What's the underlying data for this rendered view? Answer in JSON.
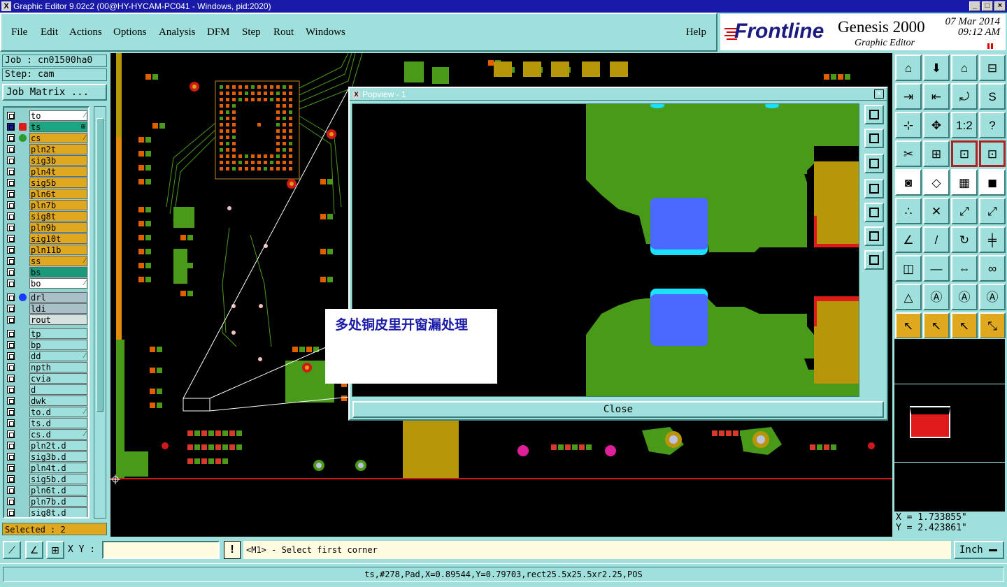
{
  "window": {
    "title": "Graphic Editor 9.02c2 (00@HY-HYCAM-PC041 - Windows, pid:2020)",
    "min": "_",
    "max": "□",
    "close": "×"
  },
  "menu": {
    "items": [
      "File",
      "Edit",
      "Actions",
      "Options",
      "Analysis",
      "DFM",
      "Step",
      "Rout",
      "Windows"
    ],
    "help": "Help"
  },
  "brand": {
    "frontline": "Frontline",
    "product": "Genesis 2000",
    "subtitle": "Graphic Editor",
    "date": "07 Mar 2014",
    "time": "09:12 AM",
    "accent": "#1a1a80"
  },
  "job": {
    "job_label": "Job : cn01500ha0",
    "step_label": "Step: cam",
    "matrix_button": "Job Matrix ..."
  },
  "layers": [
    {
      "name": "to",
      "style": "white",
      "mark": "⁄"
    },
    {
      "name": "ts",
      "style": "teal",
      "mark": "⊞",
      "active": true
    },
    {
      "name": "cs",
      "style": "gold",
      "mark": "⁄",
      "dot": "#2a9a2a"
    },
    {
      "name": "pln2t",
      "style": "gold"
    },
    {
      "name": "sig3b",
      "style": "gold"
    },
    {
      "name": "pln4t",
      "style": "gold"
    },
    {
      "name": "sig5b",
      "style": "gold"
    },
    {
      "name": "pln6t",
      "style": "gold"
    },
    {
      "name": "pln7b",
      "style": "gold"
    },
    {
      "name": "sig8t",
      "style": "gold"
    },
    {
      "name": "pln9b",
      "style": "gold"
    },
    {
      "name": "sig10t",
      "style": "gold"
    },
    {
      "name": "pln11b",
      "style": "gold"
    },
    {
      "name": "ss",
      "style": "gold",
      "mark": "⁄"
    },
    {
      "name": "bs",
      "style": "green"
    },
    {
      "name": "bo",
      "style": "white",
      "mark": "⁄"
    },
    {
      "name": "drl",
      "style": "grey",
      "dot": "#1a3aff",
      "gap": true
    },
    {
      "name": "ldi",
      "style": "grey"
    },
    {
      "name": "rout",
      "style": "lgrey"
    },
    {
      "name": "tp",
      "style": "cyan",
      "gap": true
    },
    {
      "name": "bp",
      "style": "cyan"
    },
    {
      "name": "dd",
      "style": "cyan",
      "mark": "⁄"
    },
    {
      "name": "npth",
      "style": "cyan"
    },
    {
      "name": "cvia",
      "style": "cyan"
    },
    {
      "name": "d",
      "style": "cyan"
    },
    {
      "name": "dwk",
      "style": "cyan"
    },
    {
      "name": "to.d",
      "style": "cyan",
      "mark": "⁄"
    },
    {
      "name": "ts.d",
      "style": "cyan"
    },
    {
      "name": "cs.d",
      "style": "cyan",
      "mark": "⁄"
    },
    {
      "name": "pln2t.d",
      "style": "cyan"
    },
    {
      "name": "sig3b.d",
      "style": "cyan"
    },
    {
      "name": "pln4t.d",
      "style": "cyan"
    },
    {
      "name": "sig5b.d",
      "style": "cyan"
    },
    {
      "name": "pln6t.d",
      "style": "cyan"
    },
    {
      "name": "pln7b.d",
      "style": "cyan"
    },
    {
      "name": "sig8t.d",
      "style": "cyan"
    }
  ],
  "selected_label": "Selected : 2",
  "popview": {
    "title": "Popview - 1",
    "close_label": "Close",
    "close_x": "×"
  },
  "note": {
    "text": "多处铜皮里开窗漏处理"
  },
  "tools": {
    "rows": [
      [
        "⌂",
        "⬇",
        "⌂",
        "⊟"
      ],
      [
        "⇥",
        "⇤",
        "⤾",
        "S"
      ],
      [
        "⊹",
        "✥",
        "1:2",
        "?"
      ],
      [
        "✂",
        "⊞",
        "⊡",
        "⊡"
      ],
      [
        "◙",
        "◇",
        "▦",
        "◼"
      ],
      [
        "∴",
        "✕",
        "⤢",
        "⤢"
      ],
      [
        "∠",
        "/",
        "↻",
        "╪"
      ],
      [
        "◫",
        "—",
        "⇔",
        "∞"
      ],
      [
        "△",
        "Ⓐ",
        "Ⓐ",
        "Ⓐ"
      ],
      [
        "↖",
        "↖",
        "↖",
        "⤡"
      ]
    ]
  },
  "coords": {
    "x": "X = 1.733855\"",
    "y": "Y = 2.423861\""
  },
  "bottom": {
    "xy_label": "X Y :",
    "xy_value": "",
    "warn": "!",
    "prompt": "<M1> - Select first corner",
    "unit": "Inch"
  },
  "status": {
    "text": "ts,#278,Pad,X=0.89544,Y=0.79703,rect25.5x25.5xr2.25,POS"
  },
  "colors": {
    "panel": "#9fe0dc",
    "copper": "#b8960a",
    "mask": "#4a9a1a",
    "pad": "#e06000",
    "hole": "#cc1a1a",
    "blue_pad": "#4a6aff",
    "cyan_edge": "#1ae0ff"
  }
}
